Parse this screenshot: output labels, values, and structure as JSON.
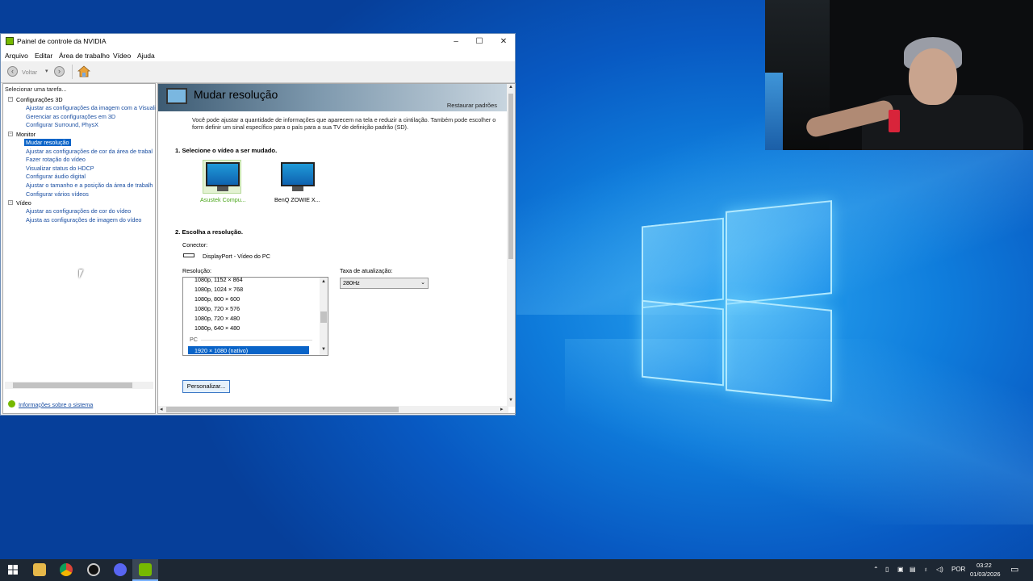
{
  "window": {
    "title": "Painel de controle da NVIDIA",
    "controls": {
      "minimize": "–",
      "maximize": "☐",
      "close": "✕"
    }
  },
  "menu": [
    "Arquivo",
    "Editar",
    "Área de trabalho",
    "Vídeo",
    "Ajuda"
  ],
  "toolbar": {
    "back_label": "Voltar"
  },
  "sidebar": {
    "header": "Selecionar uma tarefa...",
    "groups": [
      {
        "label": "Configurações 3D",
        "items": [
          "Ajustar as configurações da imagem com a Visuali",
          "Gerenciar as configurações em 3D",
          "Configurar Surround, PhysX"
        ]
      },
      {
        "label": "Monitor",
        "items": [
          "Mudar resolução",
          "Ajustar as configurações de cor da área de trabal",
          "Fazer rotação do vídeo",
          "Visualizar status do HDCP",
          "Configurar áudio digital",
          "Ajustar o tamanho e a posição da área de trabalh",
          "Configurar vários vídeos"
        ]
      },
      {
        "label": "Vídeo",
        "items": [
          "Ajustar as configurações de cor do vídeo",
          "Ajusta as configurações de imagem do vídeo"
        ]
      }
    ],
    "footer_link": "Informações sobre o sistema"
  },
  "main": {
    "title": "Mudar resolução",
    "restore": "Restaurar padrões",
    "description": "Você pode ajustar a quantidade de informações que aparecem na tela e reduzir a cintilação. Também pode escolher o form definir um sinal específico para o país para a sua TV de definição padrão (SD).",
    "section1": "1. Selecione o vídeo a ser mudado.",
    "monitors": [
      "Asustek Compu...",
      "BenQ ZOWIE X..."
    ],
    "section2": "2. Escolha a resolução.",
    "connector_label": "Conector:",
    "connector_value": "DisplayPort - Vídeo do PC",
    "resolution_label": "Resolução:",
    "resolutions": [
      "1080p, 1152 × 864",
      "1080p, 1024 × 768",
      "1080p, 800 × 600",
      "1080p, 720 × 576",
      "1080p, 720 × 480",
      "1080p, 640 × 480"
    ],
    "pc_group": "PC",
    "selected_resolution": "1920 × 1080 (nativo)",
    "refresh_label": "Taxa de atualização:",
    "refresh_value": "280Hz",
    "customize": "Personalizar..."
  },
  "taskbar": {
    "language": "POR",
    "time": "03:22",
    "date": "01/03/2026"
  },
  "colors": {
    "nvidia_green": "#76b900",
    "selection": "#0a64c8",
    "link": "#1a4ea1"
  }
}
